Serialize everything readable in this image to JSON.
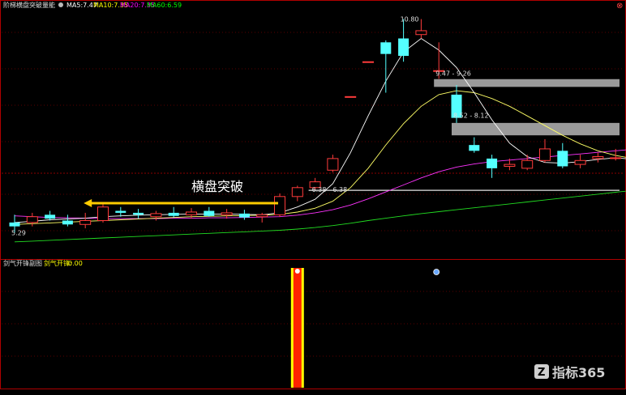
{
  "window": {
    "close_label": "⊗"
  },
  "header": {
    "title": "阶梯横盘突破量能",
    "indicators": [
      {
        "label": "MA5:",
        "value": "7.47",
        "color": "#ffffff"
      },
      {
        "label": "MA10:",
        "value": "7.35",
        "color": "#ffff00"
      },
      {
        "label": "MA20:",
        "value": "7.35",
        "color": "#ff00ff"
      },
      {
        "label": "MA60:",
        "value": "6.59",
        "color": "#00ff00"
      }
    ]
  },
  "sub_header": {
    "title": "剑气开锋副图",
    "series_label": "剑气开锋:",
    "series_value": "0.00"
  },
  "annotation": {
    "text": "横盘突破"
  },
  "watermark": {
    "text": "指标365"
  },
  "colors": {
    "up": "#ff3b3b",
    "down": "#54ffff",
    "ma5": "#ffffff",
    "ma10": "#ffff66",
    "ma20": "#ff33ff",
    "ma60": "#22dd22",
    "zone": "#9a9a9a",
    "arrow": "#ffcc00",
    "frame": "#b00000"
  },
  "chart_data": {
    "type": "candlestick",
    "ylim": [
      4.9,
      11.0
    ],
    "price_labels": [
      {
        "text": "5.29",
        "index": 0,
        "price": 5.29
      },
      {
        "text": "10.80",
        "index": 22,
        "price": 10.8
      },
      {
        "text": "9.47 - 9.26",
        "index": 24,
        "price": 9.4
      },
      {
        "text": "8.52 - 8.12",
        "index": 25,
        "price": 8.32
      },
      {
        "text": "6.38 - 6.38",
        "index": 17,
        "price": 6.4
      }
    ],
    "zones": [
      {
        "from_index": 24,
        "price_top": 9.25,
        "price_bottom": 9.05
      },
      {
        "from_index": 25,
        "price_top": 8.12,
        "price_bottom": 7.8
      }
    ],
    "support_line": {
      "from_index": 17,
      "price": 6.38
    },
    "arrow": {
      "from_index": 15,
      "to_index": 4,
      "price": 6.05
    },
    "candles": [
      {
        "o": 5.55,
        "h": 5.75,
        "l": 5.29,
        "c": 5.45
      },
      {
        "o": 5.55,
        "h": 5.8,
        "l": 5.45,
        "c": 5.7
      },
      {
        "o": 5.75,
        "h": 5.85,
        "l": 5.6,
        "c": 5.65
      },
      {
        "o": 5.6,
        "h": 5.75,
        "l": 5.45,
        "c": 5.5
      },
      {
        "o": 5.5,
        "h": 5.8,
        "l": 5.4,
        "c": 5.6
      },
      {
        "o": 5.6,
        "h": 6.05,
        "l": 5.55,
        "c": 5.95
      },
      {
        "o": 5.85,
        "h": 5.95,
        "l": 5.7,
        "c": 5.8
      },
      {
        "o": 5.8,
        "h": 5.9,
        "l": 5.65,
        "c": 5.75
      },
      {
        "o": 5.7,
        "h": 5.85,
        "l": 5.6,
        "c": 5.78
      },
      {
        "o": 5.8,
        "h": 5.95,
        "l": 5.68,
        "c": 5.72
      },
      {
        "o": 5.75,
        "h": 5.92,
        "l": 5.65,
        "c": 5.82
      },
      {
        "o": 5.85,
        "h": 5.95,
        "l": 5.7,
        "c": 5.72
      },
      {
        "o": 5.75,
        "h": 5.9,
        "l": 5.65,
        "c": 5.8
      },
      {
        "o": 5.78,
        "h": 5.88,
        "l": 5.62,
        "c": 5.68
      },
      {
        "o": 5.7,
        "h": 5.8,
        "l": 5.55,
        "c": 5.75
      },
      {
        "o": 5.75,
        "h": 6.3,
        "l": 5.7,
        "c": 6.22
      },
      {
        "o": 6.22,
        "h": 6.5,
        "l": 6.1,
        "c": 6.45
      },
      {
        "o": 6.45,
        "h": 6.7,
        "l": 6.4,
        "c": 6.6
      },
      {
        "o": 6.9,
        "h": 7.3,
        "l": 6.85,
        "c": 7.2
      },
      {
        "o": 8.8,
        "h": 8.8,
        "l": 8.78,
        "c": 8.8
      },
      {
        "o": 9.7,
        "h": 9.7,
        "l": 9.68,
        "c": 9.7
      },
      {
        "o": 10.2,
        "h": 10.25,
        "l": 8.9,
        "c": 9.9
      },
      {
        "o": 10.3,
        "h": 10.8,
        "l": 9.7,
        "c": 9.85
      },
      {
        "o": 10.4,
        "h": 10.8,
        "l": 10.3,
        "c": 10.5
      },
      {
        "o": 9.45,
        "h": 10.2,
        "l": 9.26,
        "c": 9.47
      },
      {
        "o": 8.85,
        "h": 9.1,
        "l": 8.12,
        "c": 8.25
      },
      {
        "o": 7.55,
        "h": 7.75,
        "l": 7.35,
        "c": 7.4
      },
      {
        "o": 7.2,
        "h": 7.3,
        "l": 6.7,
        "c": 6.95
      },
      {
        "o": 7.0,
        "h": 7.2,
        "l": 6.9,
        "c": 7.05
      },
      {
        "o": 6.95,
        "h": 7.3,
        "l": 6.9,
        "c": 7.15
      },
      {
        "o": 7.15,
        "h": 7.7,
        "l": 7.1,
        "c": 7.45
      },
      {
        "o": 7.4,
        "h": 7.6,
        "l": 6.95,
        "c": 7.0
      },
      {
        "o": 7.05,
        "h": 7.3,
        "l": 6.95,
        "c": 7.15
      },
      {
        "o": 7.2,
        "h": 7.35,
        "l": 7.1,
        "c": 7.25
      },
      {
        "o": 7.2,
        "h": 7.45,
        "l": 7.15,
        "c": 7.22
      },
      {
        "o": 7.22,
        "h": 7.4,
        "l": 7.05,
        "c": 7.1
      }
    ],
    "ma5": [
      5.55,
      5.58,
      5.62,
      5.64,
      5.66,
      5.7,
      5.72,
      5.74,
      5.75,
      5.76,
      5.77,
      5.77,
      5.77,
      5.76,
      5.75,
      5.8,
      5.95,
      6.15,
      6.55,
      7.35,
      8.3,
      9.2,
      9.95,
      10.3,
      10.0,
      9.55,
      8.9,
      8.2,
      7.6,
      7.25,
      7.1,
      7.08,
      7.12,
      7.18,
      7.22,
      7.18
    ],
    "ma10": [
      5.5,
      5.52,
      5.54,
      5.56,
      5.58,
      5.6,
      5.62,
      5.64,
      5.66,
      5.68,
      5.7,
      5.71,
      5.72,
      5.73,
      5.74,
      5.76,
      5.82,
      5.92,
      6.1,
      6.45,
      6.95,
      7.55,
      8.1,
      8.55,
      8.85,
      8.95,
      8.9,
      8.75,
      8.55,
      8.3,
      8.05,
      7.8,
      7.58,
      7.4,
      7.28,
      7.2
    ],
    "ma20": [
      5.72,
      5.7,
      5.68,
      5.67,
      5.66,
      5.65,
      5.65,
      5.65,
      5.65,
      5.66,
      5.66,
      5.67,
      5.67,
      5.68,
      5.69,
      5.7,
      5.74,
      5.8,
      5.88,
      6.0,
      6.16,
      6.34,
      6.52,
      6.7,
      6.86,
      6.98,
      7.06,
      7.12,
      7.16,
      7.2,
      7.24,
      7.28,
      7.32,
      7.36,
      7.4,
      7.44
    ],
    "ma60": [
      5.05,
      5.07,
      5.09,
      5.11,
      5.13,
      5.15,
      5.17,
      5.19,
      5.21,
      5.23,
      5.25,
      5.27,
      5.29,
      5.31,
      5.33,
      5.35,
      5.38,
      5.42,
      5.47,
      5.53,
      5.6,
      5.66,
      5.72,
      5.78,
      5.83,
      5.88,
      5.93,
      5.98,
      6.03,
      6.08,
      6.13,
      6.18,
      6.23,
      6.28,
      6.33,
      6.38
    ],
    "signal": {
      "bar_index": 16,
      "dot_index": 24,
      "colors": {
        "outer": "#ffff00",
        "inner": "#ff2200"
      }
    }
  }
}
